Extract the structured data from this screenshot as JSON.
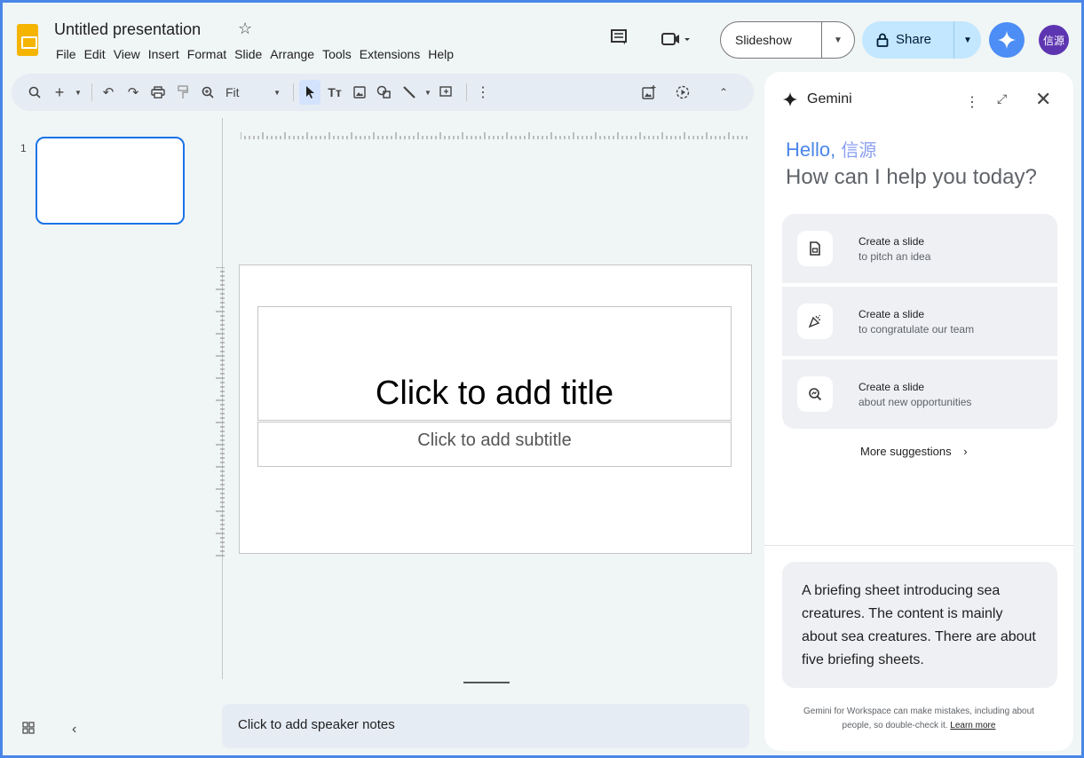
{
  "app": {
    "title": "Untitled presentation",
    "menu": [
      "File",
      "Edit",
      "View",
      "Insert",
      "Format",
      "Slide",
      "Arrange",
      "Tools",
      "Extensions",
      "Help"
    ],
    "slideshow_label": "Slideshow",
    "share_label": "Share",
    "avatar_text": "信源",
    "accent_color": "#4a86e8"
  },
  "toolbar": {
    "zoom_label": "Fit"
  },
  "filmstrip": {
    "slide_number": "1"
  },
  "slide": {
    "title_placeholder": "Click to add title",
    "subtitle_placeholder": "Click to add subtitle"
  },
  "notes": {
    "placeholder": "Click to add speaker notes"
  },
  "gemini": {
    "name": "Gemini",
    "hello": "Hello,",
    "user_name": "信源",
    "prompt": "How can I help you today?",
    "suggestions": [
      {
        "icon": "document-icon",
        "title": "Create a slide",
        "subtitle": "to pitch an idea"
      },
      {
        "icon": "celebration-icon",
        "title": "Create a slide",
        "subtitle": "to congratulate our team"
      },
      {
        "icon": "search-insights-icon",
        "title": "Create a slide",
        "subtitle": "about new opportunities"
      }
    ],
    "more_suggestions": "More suggestions",
    "response_text": "A briefing sheet introducing sea creatures. The content is mainly about sea creatures. There are about five briefing sheets.",
    "disclaimer": "Gemini for Workspace can make mistakes, including about people, so double-check it.",
    "learn_more": "Learn more"
  }
}
